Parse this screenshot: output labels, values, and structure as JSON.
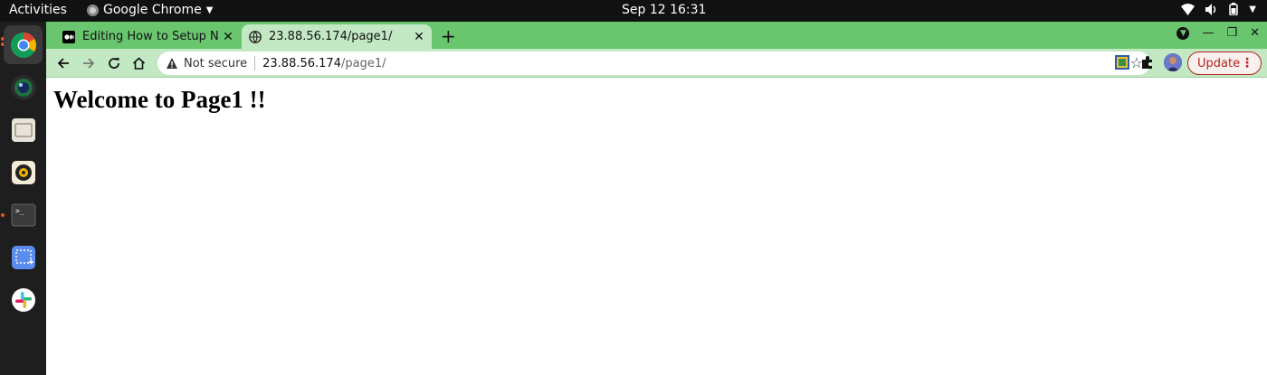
{
  "topbar": {
    "activities": "Activities",
    "app_name": "Google Chrome",
    "clock": "Sep 12  16:31"
  },
  "dock": {
    "apps": [
      "chrome-icon",
      "camera-icon",
      "files-icon",
      "rhythmbox-icon",
      "terminal-icon",
      "screenshot-icon",
      "slack-icon"
    ]
  },
  "tabs": [
    {
      "title": "Editing How to Setup Ngi",
      "active": false
    },
    {
      "title": "23.88.56.174/page1/",
      "active": true
    }
  ],
  "toolbar": {
    "security_label": "Not secure",
    "url_host": "23.88.56.174",
    "url_path": "/page1/",
    "update_label": "Update"
  },
  "page": {
    "heading": "Welcome to Page1 !!"
  },
  "colors": {
    "tabstrip": "#69c66f",
    "toolbar": "#c2e9c4",
    "update_accent": "#b3261e"
  }
}
